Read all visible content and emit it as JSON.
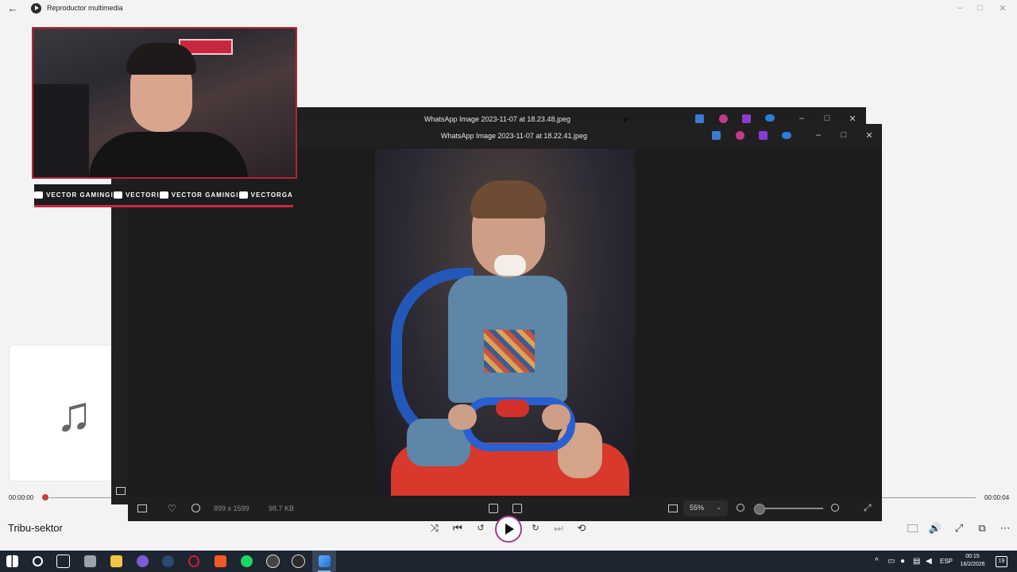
{
  "media_player": {
    "title": "Reproductor multimedia",
    "track_title": "Tribu-sektor",
    "time_elapsed": "00:00:00",
    "time_total": "00:00:04",
    "progress": 0.0
  },
  "overlay": {
    "social": [
      "VECTOR GAMING",
      "VECTOR",
      "VECTOR GAMING",
      "VECTORGA"
    ],
    "separator": "I"
  },
  "viewer_back": {
    "title": "WhatsApp Image 2023-11-07 at 18.23.48.jpeg"
  },
  "viewer_front": {
    "title": "WhatsApp Image 2023-11-07 at 18.22.41.jpeg",
    "dimensions": "899 x 1599",
    "file_size": "98.7 KB",
    "zoom": "55%",
    "zoom_level": 0.05
  },
  "taskbar": {
    "language": "ESP",
    "time": "00:15",
    "date": "16/2/2026",
    "notifications": "19"
  },
  "icons": {
    "back": "←",
    "minimize": "–",
    "maximize": "□",
    "close": "✕",
    "music": "♫"
  },
  "colors": {
    "accent_red": "#c8283f",
    "play_ring": "#9b3a8b",
    "progress_dot": "#c4432f",
    "taskbar_bg": "#1d2531"
  }
}
